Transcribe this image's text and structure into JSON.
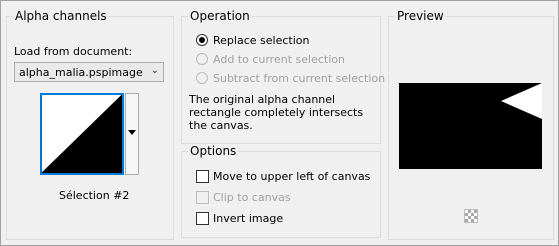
{
  "alpha_channels": {
    "title": "Alpha channels",
    "load_label": "Load from document:",
    "document_value": "alpha_malia.pspimage",
    "selection_name": "Sélection #2"
  },
  "operation": {
    "title": "Operation",
    "options": [
      {
        "label": "Replace selection",
        "checked": true,
        "enabled": true
      },
      {
        "label": "Add to current selection",
        "checked": false,
        "enabled": false
      },
      {
        "label": "Subtract from current selection",
        "checked": false,
        "enabled": false
      }
    ],
    "message": "The original alpha channel rectangle completely intersects the canvas."
  },
  "options": {
    "title": "Options",
    "items": [
      {
        "label": "Move to upper left of canvas",
        "checked": false,
        "enabled": true
      },
      {
        "label": "Clip to canvas",
        "checked": false,
        "enabled": false
      },
      {
        "label": "Invert image",
        "checked": false,
        "enabled": true
      }
    ]
  },
  "preview": {
    "title": "Preview"
  }
}
